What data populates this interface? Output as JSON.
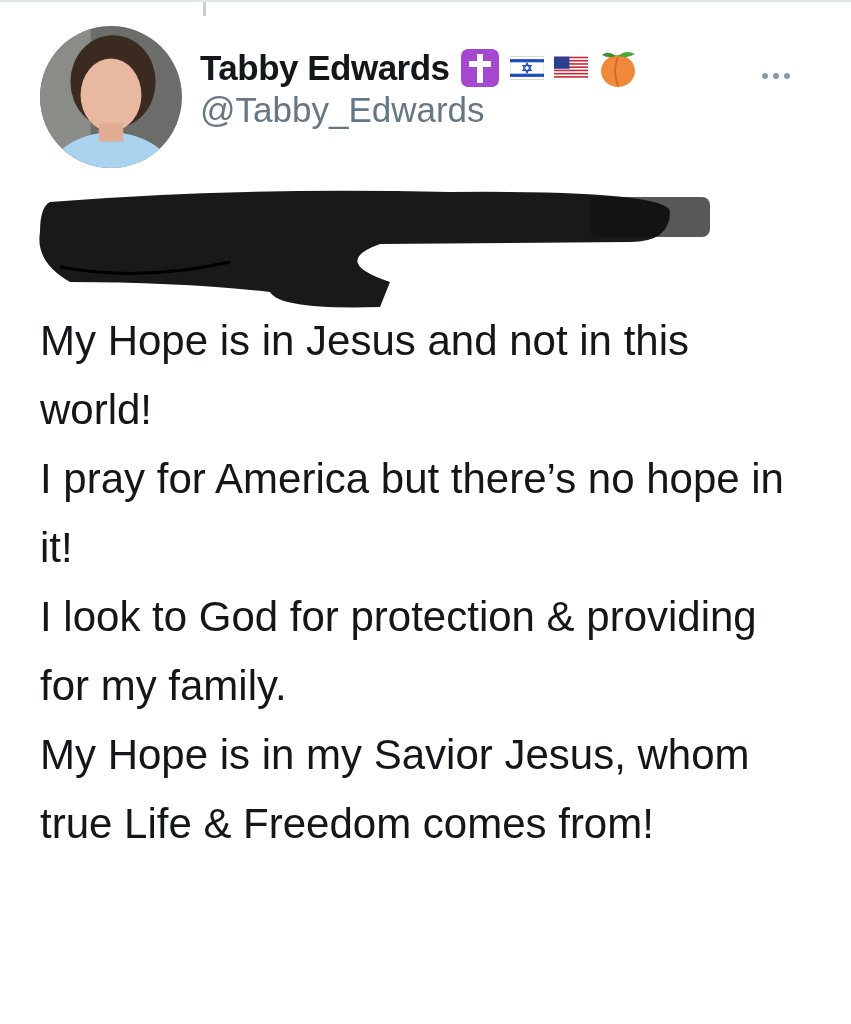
{
  "tweet": {
    "display_name": "Tabby Edwards",
    "handle": "@Tabby_Edwards",
    "lines": [
      "My Hope is in Jesus and not in this world!",
      "I pray for America but there’s no hope in it!",
      "I look to God for protection & providing for my family.",
      "My Hope is in my Savior Jesus, whom true Life & Freedom comes from!"
    ]
  }
}
